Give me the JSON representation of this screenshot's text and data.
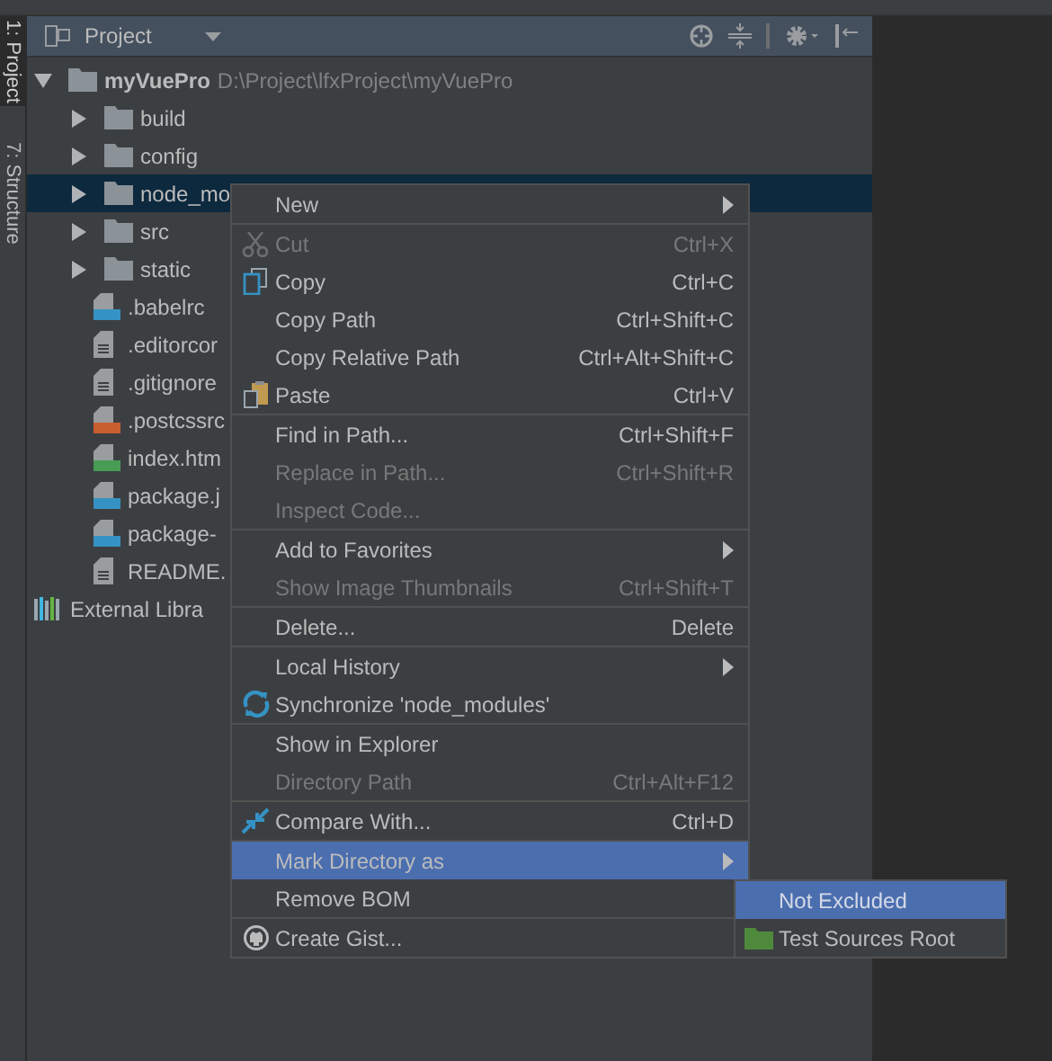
{
  "side_tabs": [
    {
      "label": "1: Project",
      "selected": true
    },
    {
      "label": "7: Structure",
      "selected": false
    }
  ],
  "panel": {
    "title": "Project"
  },
  "tree": [
    {
      "label": "myVuePro",
      "path": "D:\\Project\\lfxProject\\myVuePro",
      "kind": "folder",
      "expanded": true,
      "selected": false,
      "children": [
        {
          "label": "build",
          "kind": "folder",
          "expanded": false,
          "selected": false
        },
        {
          "label": "config",
          "kind": "folder",
          "expanded": false,
          "selected": false
        },
        {
          "label": "node_mo",
          "kind": "folder",
          "expanded": false,
          "selected": true
        },
        {
          "label": "src",
          "kind": "folder",
          "expanded": false,
          "selected": false
        },
        {
          "label": "static",
          "kind": "folder",
          "expanded": false,
          "selected": false
        },
        {
          "label": ".babelrc",
          "kind": "json",
          "selected": false
        },
        {
          "label": ".editorcor",
          "kind": "text",
          "selected": false
        },
        {
          "label": ".gitignore",
          "kind": "text",
          "selected": false
        },
        {
          "label": ".postcssrc",
          "kind": "js",
          "selected": false
        },
        {
          "label": "index.htm",
          "kind": "html",
          "selected": false
        },
        {
          "label": "package.j",
          "kind": "json",
          "selected": false
        },
        {
          "label": "package-",
          "kind": "json",
          "selected": false
        },
        {
          "label": "README.",
          "kind": "text",
          "selected": false
        }
      ]
    },
    {
      "label": "External Libra",
      "kind": "library",
      "selected": false
    }
  ],
  "menu": [
    {
      "kind": "item",
      "label": "New",
      "submenu": true,
      "disabled": false,
      "selected": false
    },
    {
      "kind": "separator"
    },
    {
      "kind": "item",
      "label": "Cut",
      "shortcut": "Ctrl+X",
      "disabled": true,
      "selected": false
    },
    {
      "kind": "item",
      "label": "Copy",
      "shortcut": "Ctrl+C",
      "disabled": false,
      "selected": false
    },
    {
      "kind": "item",
      "label": "Copy Path",
      "shortcut": "Ctrl+Shift+C",
      "disabled": false,
      "selected": false
    },
    {
      "kind": "item",
      "label": "Copy Relative Path",
      "shortcut": "Ctrl+Alt+Shift+C",
      "disabled": false,
      "selected": false
    },
    {
      "kind": "item",
      "label": "Paste",
      "shortcut": "Ctrl+V",
      "disabled": false,
      "selected": false
    },
    {
      "kind": "separator"
    },
    {
      "kind": "item",
      "label": "Find in Path...",
      "shortcut": "Ctrl+Shift+F",
      "disabled": false,
      "selected": false
    },
    {
      "kind": "item",
      "label": "Replace in Path...",
      "shortcut": "Ctrl+Shift+R",
      "disabled": true,
      "selected": false
    },
    {
      "kind": "item",
      "label": "Inspect Code...",
      "disabled": true,
      "selected": false
    },
    {
      "kind": "separator"
    },
    {
      "kind": "item",
      "label": "Add to Favorites",
      "submenu": true,
      "disabled": false,
      "selected": false
    },
    {
      "kind": "item",
      "label": "Show Image Thumbnails",
      "shortcut": "Ctrl+Shift+T",
      "disabled": true,
      "selected": false
    },
    {
      "kind": "separator"
    },
    {
      "kind": "item",
      "label": "Delete...",
      "shortcut": "Delete",
      "disabled": false,
      "selected": false
    },
    {
      "kind": "separator"
    },
    {
      "kind": "item",
      "label": "Local History",
      "submenu": true,
      "disabled": false,
      "selected": false
    },
    {
      "kind": "item",
      "label": "Synchronize 'node_modules'",
      "disabled": false,
      "selected": false
    },
    {
      "kind": "separator"
    },
    {
      "kind": "item",
      "label": "Show in Explorer",
      "disabled": false,
      "selected": false
    },
    {
      "kind": "item",
      "label": "Directory Path",
      "shortcut": "Ctrl+Alt+F12",
      "disabled": true,
      "selected": false
    },
    {
      "kind": "separator"
    },
    {
      "kind": "item",
      "label": "Compare With...",
      "shortcut": "Ctrl+D",
      "disabled": false,
      "selected": false
    },
    {
      "kind": "separator"
    },
    {
      "kind": "item",
      "label": "Mark Directory as",
      "submenu": true,
      "disabled": false,
      "selected": true
    },
    {
      "kind": "item",
      "label": "Remove BOM",
      "disabled": false,
      "selected": false
    },
    {
      "kind": "separator"
    },
    {
      "kind": "item",
      "label": "Create Gist...",
      "disabled": false,
      "selected": false
    }
  ],
  "submenu": [
    {
      "label": "Not Excluded",
      "disabled": true,
      "selected": true
    },
    {
      "label": "Test Sources Root",
      "disabled": false,
      "selected": false
    }
  ]
}
